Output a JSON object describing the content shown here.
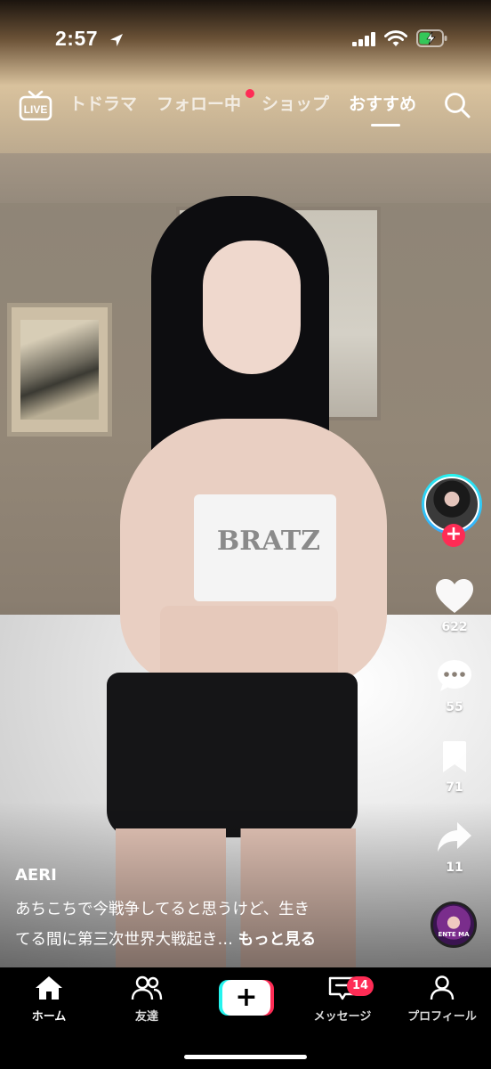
{
  "status_bar": {
    "time": "2:57"
  },
  "top_nav": {
    "live_label": "LIVE",
    "tabs": [
      {
        "label": "トドラマ"
      },
      {
        "label": "フォロー中"
      },
      {
        "label": "ショップ"
      },
      {
        "label": "おすすめ"
      }
    ],
    "active_tab": "おすすめ"
  },
  "video_overlay": {
    "shirt_text": "BRATZ"
  },
  "right_rail": {
    "likes": "622",
    "comments": "55",
    "saves": "71",
    "shares": "11",
    "follow_symbol": "+"
  },
  "music_disc": {
    "label": "ENTE MA"
  },
  "post": {
    "author": "AERI",
    "caption_line_1": "あちこちで今戦争してると思うけど、生き",
    "caption_line_2": "てる間に第三次世界大戦起き…",
    "more_label": "もっと見る"
  },
  "bottom_nav": {
    "home": "ホーム",
    "friends": "友達",
    "create_symbol": "+",
    "inbox": "メッセージ",
    "inbox_badge": "14",
    "profile": "プロフィール"
  },
  "colors": {
    "accent_red": "#fe2c55",
    "accent_cyan": "#25f4ee",
    "battery_green": "#34c759"
  }
}
